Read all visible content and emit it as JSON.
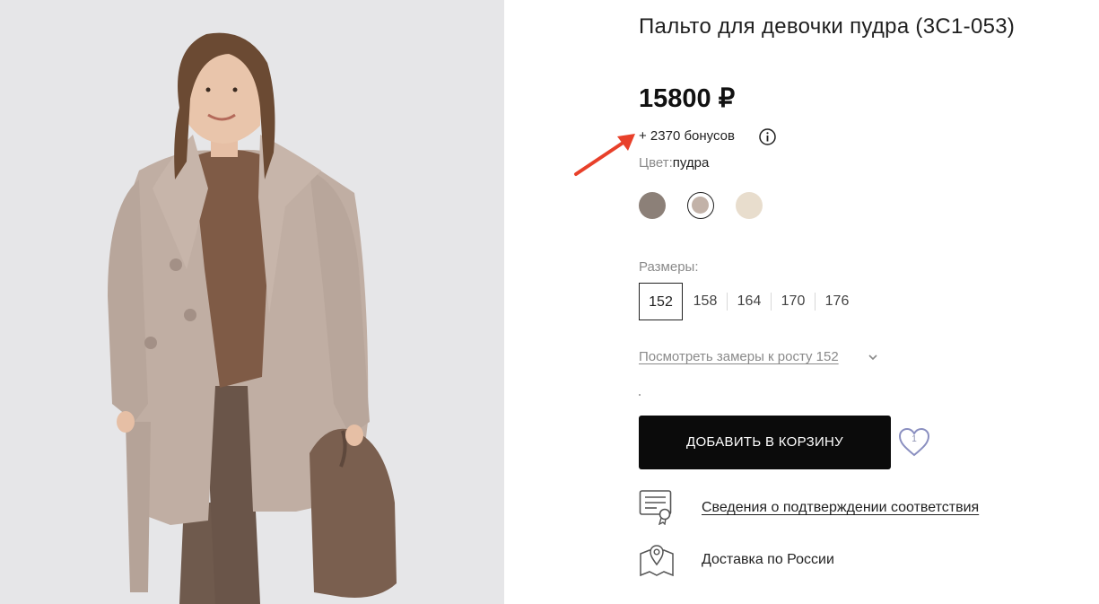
{
  "product": {
    "title": "Пальто для девочки пудра (3С1-053)",
    "price": "15800 ₽",
    "bonus": "+ 2370 бонусов",
    "color_label": "Цвет:",
    "color_value": "пудра"
  },
  "swatches": [
    {
      "name": "taupe",
      "color": "#8c8078",
      "selected": false
    },
    {
      "name": "powder",
      "color": "#c2b2a8",
      "selected": true
    },
    {
      "name": "cream",
      "color": "#e8ddcd",
      "selected": false
    }
  ],
  "sizes": {
    "label": "Размеры:",
    "options": [
      "152",
      "158",
      "164",
      "170",
      "176"
    ],
    "selected": "152"
  },
  "measure_link": "Посмотреть замеры к росту 152",
  "cart": {
    "button_label": "ДОБАВИТЬ В КОРЗИНУ",
    "wishlist_count": "1"
  },
  "features": {
    "certificate": "Сведения о подтверждении соответствия",
    "delivery": "Доставка по России"
  },
  "colors": {
    "accent_arrow": "#e8402a",
    "button_bg": "#0b0b0b",
    "heart": "#8a8fc0"
  }
}
